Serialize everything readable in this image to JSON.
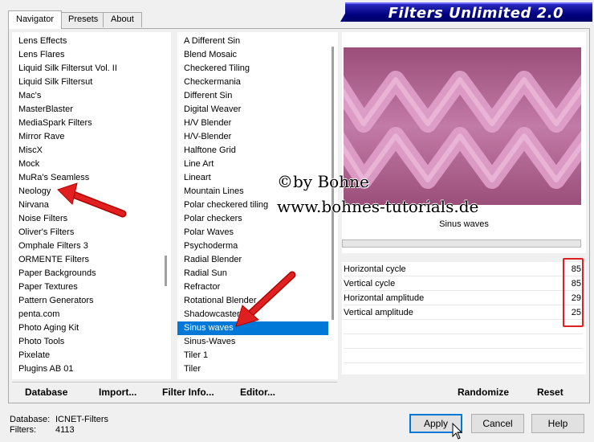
{
  "tabs": [
    {
      "label": "Navigator"
    },
    {
      "label": "Presets"
    },
    {
      "label": "About"
    }
  ],
  "banner": {
    "title": "Filters Unlimited 2.0"
  },
  "categories": [
    "Lens Effects",
    "Lens Flares",
    "Liquid Silk Filtersut Vol. II",
    "Liquid Silk Filtersut",
    "Mac's",
    "MasterBlaster",
    "MediaSpark Filters",
    "Mirror Rave",
    "MiscX",
    "Mock",
    "MuRa's Seamless",
    "Neology",
    "Nirvana",
    "Noise Filters",
    "Oliver's Filters",
    "Omphale Filters 3",
    "ORMENTE Filters",
    "Paper Backgrounds",
    "Paper Textures",
    "Pattern Generators",
    "penta.com",
    "Photo Aging Kit",
    "Photo Tools",
    "Pixelate",
    "Plugins AB 01"
  ],
  "filters": [
    "A Different Sin",
    "Blend Mosaic",
    "Checkered Tiling",
    "Checkermania",
    "Different Sin",
    "Digital Weaver",
    "H/V Blender",
    "H/V-Blender",
    "Halftone Grid",
    "Line Art",
    "Lineart",
    "Mountain Lines",
    "Polar checkered tiling",
    "Polar checkers",
    "Polar Waves",
    "Psychoderma",
    "Radial Blender",
    "Radial Sun",
    "Refractor",
    "Rotational Blender",
    "Shadowcaster",
    "Sinus waves",
    "Sinus-Waves",
    "Tiler 1",
    "Tiler"
  ],
  "selected_filter": "Sinus waves",
  "preview": {
    "filter_name": "Sinus waves"
  },
  "params": [
    {
      "label": "Horizontal cycle",
      "value": "85"
    },
    {
      "label": "Vertical cycle",
      "value": "85"
    },
    {
      "label": "Horizontal amplitude",
      "value": "29"
    },
    {
      "label": "Vertical amplitude",
      "value": "25"
    }
  ],
  "panel_buttons": {
    "database": "Database",
    "import": "Import...",
    "filter_info": "Filter Info...",
    "editor": "Editor...",
    "randomize": "Randomize",
    "reset": "Reset"
  },
  "footer": {
    "database_label": "Database:",
    "database_value": "ICNET-Filters",
    "filters_label": "Filters:",
    "filters_value": "4113"
  },
  "dialog_buttons": {
    "apply": "Apply",
    "cancel": "Cancel",
    "help": "Help"
  },
  "watermark": {
    "line1": "©by Bohne",
    "line2": "www.bohnes-tutorials.de"
  },
  "colors": {
    "selection": "#0078d7",
    "banner": "#00007f",
    "annotation_red": "#e02020",
    "preview_light": "#e3a3cd",
    "preview_dark": "#9a4f7a"
  }
}
